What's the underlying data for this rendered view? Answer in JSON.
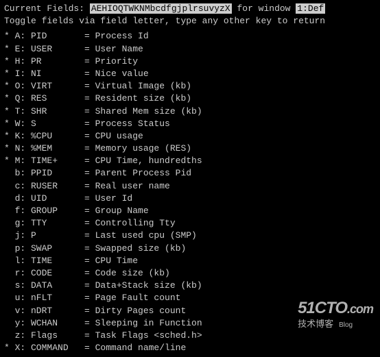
{
  "header": {
    "label": "Current Fields: ",
    "fields_string": "AEHIOQTWKNMbcdfgjplrsuvyzX",
    "mid": "  for window ",
    "window": "1:Def"
  },
  "instruction": "Toggle fields via field letter, type any other key to return",
  "rows": [
    {
      "active": true,
      "letter": "A",
      "field": "PID",
      "desc": "Process Id"
    },
    {
      "active": true,
      "letter": "E",
      "field": "USER",
      "desc": "User Name"
    },
    {
      "active": true,
      "letter": "H",
      "field": "PR",
      "desc": "Priority"
    },
    {
      "active": true,
      "letter": "I",
      "field": "NI",
      "desc": "Nice value"
    },
    {
      "active": true,
      "letter": "O",
      "field": "VIRT",
      "desc": "Virtual Image (kb)"
    },
    {
      "active": true,
      "letter": "Q",
      "field": "RES",
      "desc": "Resident size (kb)"
    },
    {
      "active": true,
      "letter": "T",
      "field": "SHR",
      "desc": "Shared Mem size (kb)"
    },
    {
      "active": true,
      "letter": "W",
      "field": "S",
      "desc": "Process Status"
    },
    {
      "active": true,
      "letter": "K",
      "field": "%CPU",
      "desc": "CPU usage"
    },
    {
      "active": true,
      "letter": "N",
      "field": "%MEM",
      "desc": "Memory usage (RES)"
    },
    {
      "active": true,
      "letter": "M",
      "field": "TIME+",
      "desc": "CPU Time, hundredths"
    },
    {
      "active": false,
      "letter": "b",
      "field": "PPID",
      "desc": "Parent Process Pid"
    },
    {
      "active": false,
      "letter": "c",
      "field": "RUSER",
      "desc": "Real user name"
    },
    {
      "active": false,
      "letter": "d",
      "field": "UID",
      "desc": "User Id"
    },
    {
      "active": false,
      "letter": "f",
      "field": "GROUP",
      "desc": "Group Name"
    },
    {
      "active": false,
      "letter": "g",
      "field": "TTY",
      "desc": "Controlling Tty"
    },
    {
      "active": false,
      "letter": "j",
      "field": "P",
      "desc": "Last used cpu (SMP)"
    },
    {
      "active": false,
      "letter": "p",
      "field": "SWAP",
      "desc": "Swapped size (kb)"
    },
    {
      "active": false,
      "letter": "l",
      "field": "TIME",
      "desc": "CPU Time"
    },
    {
      "active": false,
      "letter": "r",
      "field": "CODE",
      "desc": "Code size (kb)"
    },
    {
      "active": false,
      "letter": "s",
      "field": "DATA",
      "desc": "Data+Stack size (kb)"
    },
    {
      "active": false,
      "letter": "u",
      "field": "nFLT",
      "desc": "Page Fault count"
    },
    {
      "active": false,
      "letter": "v",
      "field": "nDRT",
      "desc": "Dirty Pages count"
    },
    {
      "active": false,
      "letter": "y",
      "field": "WCHAN",
      "desc": "Sleeping in Function"
    },
    {
      "active": false,
      "letter": "z",
      "field": "Flags",
      "desc": "Task Flags <sched.h>"
    },
    {
      "active": true,
      "letter": "X",
      "field": "COMMAND",
      "desc": "Command name/line"
    }
  ],
  "watermark": {
    "main": "51CTO",
    "suffix": ".com",
    "sub": "技术博客",
    "blog": "Blog"
  }
}
